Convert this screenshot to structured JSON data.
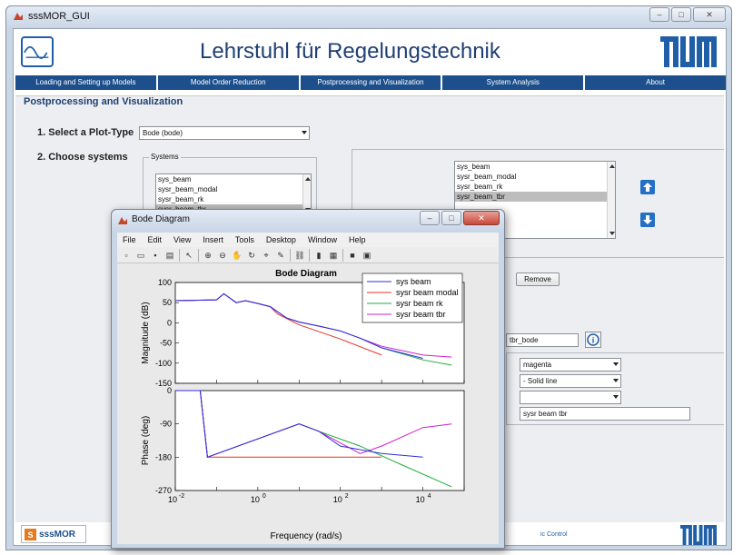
{
  "main_window": {
    "title": "sssMOR_GUI",
    "banner_title": "Lehrstuhl für Regelungstechnik",
    "tabs": [
      "Loading and Setting up Models",
      "Model Order Reduction",
      "Postprocessing and Visualization",
      "System Analysis",
      "About"
    ],
    "panel_title": "Postprocessing and Visualization",
    "plot_type_label": "1. Select a Plot-Type",
    "plot_type_value": "Bode (bode)",
    "choose_systems_label": "2. Choose systems",
    "systems_group_title": "Systems",
    "systems_list": [
      "sys_beam",
      "sysr_beam_modal",
      "sysr_beam_rk",
      "sysr_beam_tbr"
    ],
    "selected_list": [
      "sys_beam",
      "sysr_beam_modal",
      "sysr_beam_rk",
      "sysr_beam_tbr"
    ],
    "remove_button": "Remove",
    "plot_name_value": "tbr_bode",
    "color_value": "magenta",
    "linestyle_value": "-   Solid line",
    "marker_value": "",
    "legend_value": "sysr beam tbr",
    "footer_logo_text": "sssMOR",
    "footer_text": "ic Control",
    "colors": {
      "accent_blue": "#1c4f8c",
      "title_blue": "#1f3f73"
    }
  },
  "figure_window": {
    "title": "Bode Diagram",
    "menu": [
      "File",
      "Edit",
      "View",
      "Insert",
      "Tools",
      "Desktop",
      "Window",
      "Help"
    ],
    "toolbar_icons": [
      "new-file-icon",
      "open-icon",
      "save-icon",
      "print-icon",
      "pointer-icon",
      "zoom-in-icon",
      "zoom-out-icon",
      "pan-icon",
      "rotate-icon",
      "data-cursor-icon",
      "brush-icon",
      "link-icon",
      "colorbar-icon",
      "legend-icon",
      "hide-tools-icon",
      "show-tools-icon"
    ]
  },
  "chart_data": {
    "type": "line",
    "title": "Bode Diagram",
    "xlabel": "Frequency  (rad/s)",
    "xscale": "log",
    "xlim": [
      0.01,
      100000
    ],
    "x_ticks": [
      "10",
      "10",
      "10",
      "10"
    ],
    "x_tick_exponents": [
      "-2",
      "0",
      "2",
      "4"
    ],
    "legend_position": "top-right",
    "series": [
      {
        "name": "sys beam",
        "color": "#2d2de0"
      },
      {
        "name": "sysr beam modal",
        "color": "#e53322"
      },
      {
        "name": "sysr beam rk",
        "color": "#1fae3a"
      },
      {
        "name": "sysr beam tbr",
        "color": "#cc1fcc"
      }
    ],
    "subplots": [
      {
        "ylabel": "Magnitude (dB)",
        "ylim": [
          -150,
          100
        ],
        "yticks": [
          100,
          50,
          0,
          -50,
          -100,
          -150
        ],
        "series_points": {
          "sys beam": [
            [
              0.01,
              55
            ],
            [
              0.1,
              57
            ],
            [
              0.15,
              72
            ],
            [
              0.3,
              50
            ],
            [
              0.5,
              55
            ],
            [
              1,
              48
            ],
            [
              2,
              40
            ],
            [
              5,
              12
            ],
            [
              10,
              2
            ],
            [
              30,
              -8
            ],
            [
              100,
              -20
            ],
            [
              300,
              -38
            ],
            [
              1000,
              -62
            ],
            [
              10000,
              -88
            ]
          ],
          "sysr beam modal": [
            [
              0.01,
              55
            ],
            [
              0.1,
              57
            ],
            [
              0.15,
              72
            ],
            [
              0.3,
              50
            ],
            [
              0.5,
              55
            ],
            [
              1,
              48
            ],
            [
              2,
              40
            ],
            [
              3,
              22
            ],
            [
              10,
              -5
            ],
            [
              100,
              -40
            ],
            [
              1000,
              -80
            ]
          ],
          "sysr beam rk": [
            [
              0.01,
              55
            ],
            [
              0.1,
              57
            ],
            [
              0.15,
              72
            ],
            [
              0.3,
              50
            ],
            [
              0.5,
              55
            ],
            [
              1,
              48
            ],
            [
              2,
              40
            ],
            [
              5,
              12
            ],
            [
              10,
              2
            ],
            [
              30,
              -8
            ],
            [
              100,
              -20
            ],
            [
              300,
              -38
            ],
            [
              1000,
              -62
            ],
            [
              10000,
              -92
            ],
            [
              50000,
              -105
            ]
          ],
          "sysr beam tbr": [
            [
              0.01,
              55
            ],
            [
              0.1,
              57
            ],
            [
              0.15,
              72
            ],
            [
              0.3,
              50
            ],
            [
              0.5,
              55
            ],
            [
              1,
              48
            ],
            [
              2,
              40
            ],
            [
              5,
              12
            ],
            [
              10,
              2
            ],
            [
              30,
              -8
            ],
            [
              100,
              -20
            ],
            [
              300,
              -38
            ],
            [
              1000,
              -58
            ],
            [
              10000,
              -80
            ],
            [
              50000,
              -85
            ]
          ]
        }
      },
      {
        "ylabel": "Phase (deg)",
        "ylim": [
          -270,
          0
        ],
        "yticks": [
          0,
          -90,
          -180,
          -270
        ],
        "series_points": {
          "sys beam": [
            [
              0.01,
              0
            ],
            [
              0.04,
              0
            ],
            [
              0.06,
              -180
            ],
            [
              10,
              -90
            ],
            [
              30,
              -110
            ],
            [
              100,
              -150
            ],
            [
              1000,
              -170
            ],
            [
              10000,
              -180
            ]
          ],
          "sysr beam modal": [
            [
              0.01,
              0
            ],
            [
              0.04,
              0
            ],
            [
              0.06,
              -180
            ],
            [
              5,
              -180
            ],
            [
              10,
              -180
            ],
            [
              1000,
              -180
            ]
          ],
          "sysr beam rk": [
            [
              0.01,
              0
            ],
            [
              0.04,
              0
            ],
            [
              0.06,
              -180
            ],
            [
              10,
              -90
            ],
            [
              30,
              -110
            ],
            [
              300,
              -150
            ],
            [
              3000,
              -200
            ],
            [
              50000,
              -260
            ]
          ],
          "sysr beam tbr": [
            [
              0.01,
              0
            ],
            [
              0.04,
              0
            ],
            [
              0.06,
              -180
            ],
            [
              10,
              -90
            ],
            [
              30,
              -110
            ],
            [
              300,
              -170
            ],
            [
              1000,
              -150
            ],
            [
              10000,
              -100
            ],
            [
              50000,
              -90
            ]
          ]
        }
      }
    ]
  }
}
